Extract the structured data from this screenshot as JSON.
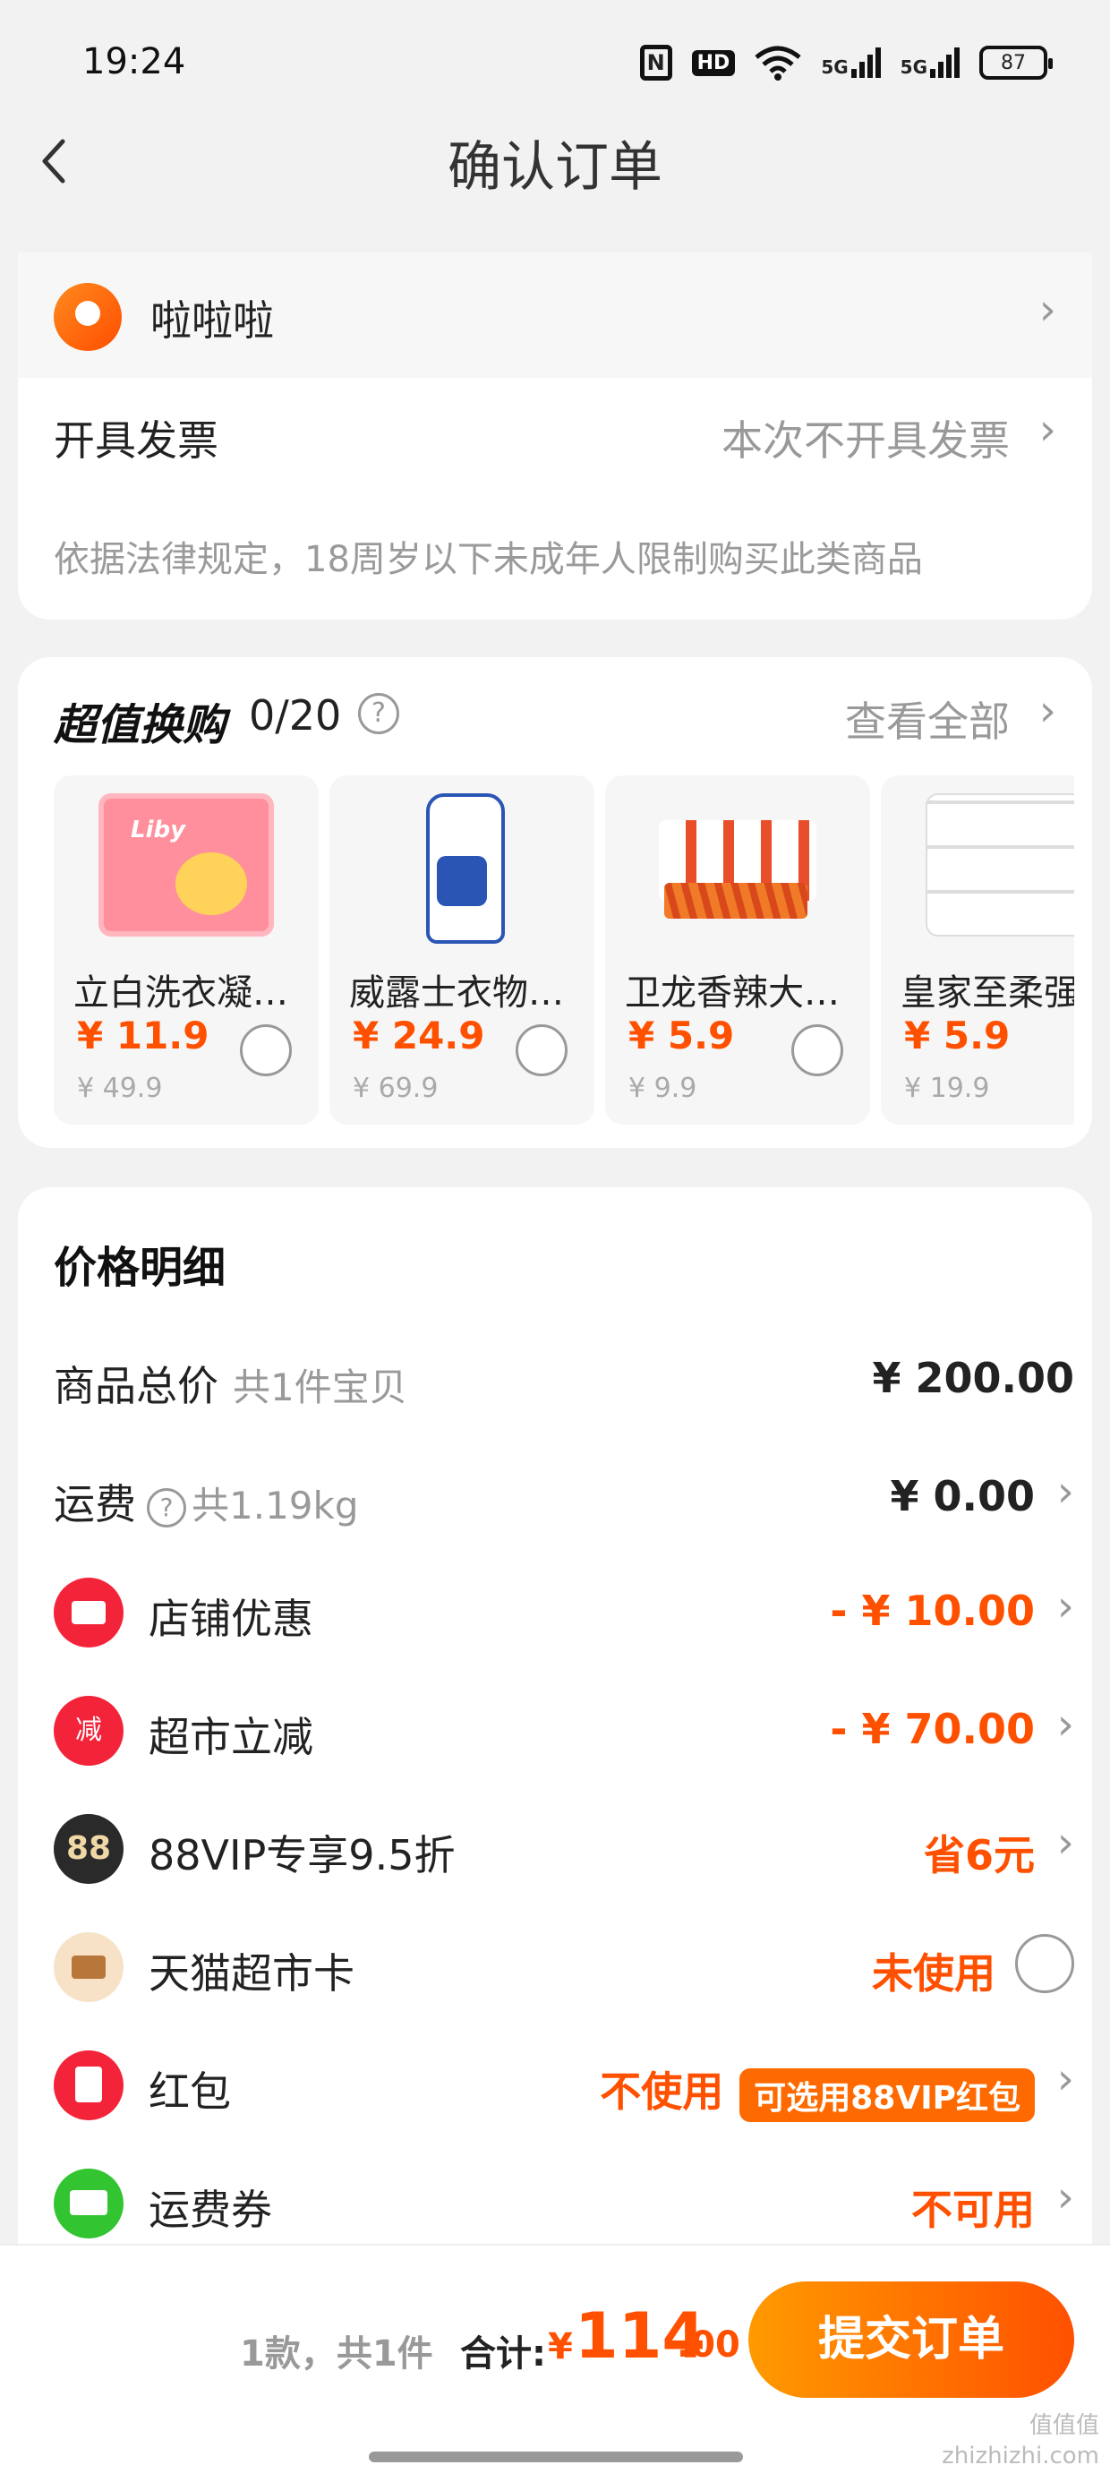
{
  "status_bar": {
    "time": "19:24",
    "hd_label": "HD",
    "net1": "5G",
    "net2": "5G",
    "battery": "87"
  },
  "header": {
    "back_icon": "chevron-left-icon",
    "title": "确认订单"
  },
  "address": {
    "name": "啦啦啦",
    "icon": "location-pin-icon"
  },
  "invoice": {
    "label": "开具发票",
    "value": "本次不开具发票",
    "notice": "依据法律规定，18周岁以下未成年人限制购买此类商品"
  },
  "exchange": {
    "title": "超值换购",
    "count": "0/20",
    "help": "?",
    "view_all": "查看全部",
    "products": [
      {
        "name": "立白洗衣凝珠...",
        "price": "¥ 11.9",
        "original": "¥ 49.9"
      },
      {
        "name": "威露士衣物除...",
        "price": "¥ 24.9",
        "original": "¥ 69.9"
      },
      {
        "name": "卫龙香辣大面...",
        "price": "¥ 5.9",
        "original": "¥ 9.9"
      },
      {
        "name": "皇家至柔强",
        "price": "¥ 5.9",
        "original": "¥ 19.9"
      }
    ]
  },
  "price_detail": {
    "title": "价格明细",
    "goods_total": {
      "label": "商品总价",
      "sub": "共1件宝贝",
      "value": "¥ 200.00"
    },
    "shipping": {
      "label": "运费",
      "sub": "共1.19kg",
      "value": "¥ 0.00"
    },
    "shop_discount": {
      "label": "店铺优惠",
      "value": "- ¥ 10.00"
    },
    "market_cut": {
      "label": "超市立减",
      "icon_text": "减",
      "value": "- ¥ 70.00"
    },
    "vip": {
      "label": "88VIP专享9.5折",
      "icon_text": "88",
      "value": "省6元"
    },
    "tmall_card": {
      "label": "天猫超市卡",
      "value": "未使用"
    },
    "red_packet": {
      "label": "红包",
      "value": "不使用",
      "tag": "可选用88VIP红包"
    },
    "shipping_coupon": {
      "label": "运费券",
      "value": "不可用"
    }
  },
  "footer": {
    "count": "1款，共1件",
    "total_label": "合计:",
    "currency": "¥",
    "total_int": "114",
    "total_dec": ".00",
    "submit": "提交订单"
  },
  "watermark": {
    "line1": "值值值",
    "line2": "zhizhizhi.com"
  },
  "colors": {
    "accent": "#ff5000",
    "red_icon": "#f3243a",
    "green_icon": "#33c531"
  }
}
